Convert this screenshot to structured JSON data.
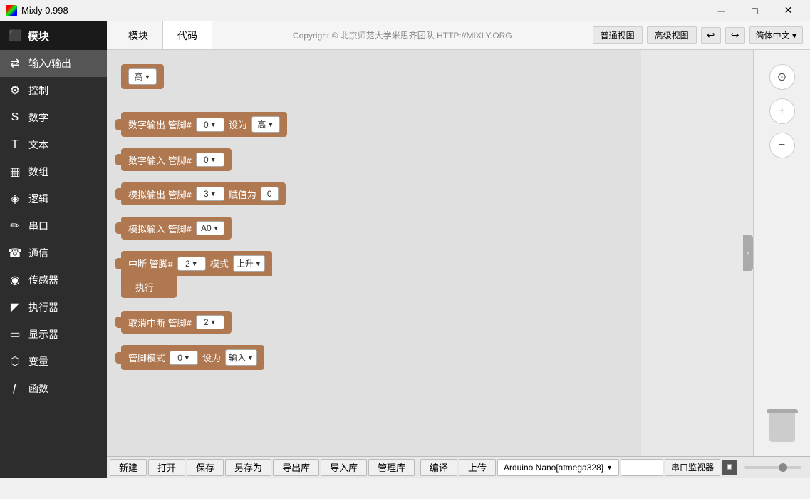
{
  "titlebar": {
    "icon_label": "M",
    "title": "Mixly 0.998",
    "minimize": "─",
    "maximize": "□",
    "close": "✕"
  },
  "tabs": {
    "blocks_label": "模块",
    "code_label": "代码"
  },
  "topbar": {
    "copyright": "Copyright © 北京师范大学米思齐团队 HTTP://MIXLY.ORG",
    "normal_view": "普通视图",
    "advanced_view": "高级视图",
    "undo": "↩",
    "redo": "↪",
    "lang": "简体中文 ▾"
  },
  "sidebar": {
    "header_label": "模块",
    "items": [
      {
        "id": "io",
        "label": "输入/输出",
        "icon": "⇄",
        "active": true
      },
      {
        "id": "control",
        "label": "控制",
        "icon": "⚙"
      },
      {
        "id": "math",
        "label": "数学",
        "icon": "S"
      },
      {
        "id": "text",
        "label": "文本",
        "icon": "T"
      },
      {
        "id": "array",
        "label": "数组",
        "icon": "▦"
      },
      {
        "id": "logic",
        "label": "逻辑",
        "icon": "◈"
      },
      {
        "id": "serial",
        "label": "串口",
        "icon": "✏"
      },
      {
        "id": "comms",
        "label": "通信",
        "icon": "☎"
      },
      {
        "id": "sensors",
        "label": "传感器",
        "icon": "◉"
      },
      {
        "id": "actuators",
        "label": "执行器",
        "icon": "◤"
      },
      {
        "id": "display",
        "label": "显示器",
        "icon": "▭"
      },
      {
        "id": "vars",
        "label": "变量",
        "icon": "⬡"
      },
      {
        "id": "funcs",
        "label": "函数",
        "icon": "ƒ"
      }
    ]
  },
  "blocks": [
    {
      "id": "digital-high",
      "type": "standalone",
      "text": "高",
      "has_dropdown": true
    },
    {
      "id": "digital-output",
      "type": "normal",
      "label": "数字输出 管脚#",
      "pin_value": "0",
      "pin_dropdown": true,
      "set_label": "设为",
      "set_value": "高",
      "set_dropdown": true
    },
    {
      "id": "digital-input",
      "type": "normal",
      "label": "数字输入 管脚#",
      "pin_value": "0",
      "pin_dropdown": true
    },
    {
      "id": "analog-output",
      "type": "normal",
      "label": "模拟输出 管脚#",
      "pin_value": "3",
      "pin_dropdown": true,
      "assign_label": "赋值为",
      "assign_value": "0"
    },
    {
      "id": "analog-input",
      "type": "normal",
      "label": "模拟输入 管脚#",
      "pin_value": "A0",
      "pin_dropdown": true
    },
    {
      "id": "interrupt",
      "type": "interrupt",
      "line1_label": "中断 管脚#",
      "pin_value": "2",
      "pin_dropdown": true,
      "mode_label": "模式",
      "mode_value": "上升",
      "mode_dropdown": true,
      "line2_label": "执行"
    },
    {
      "id": "cancel-interrupt",
      "type": "normal",
      "label": "取消中断 管脚#",
      "pin_value": "2",
      "pin_dropdown": true
    },
    {
      "id": "pin-mode",
      "type": "normal",
      "label": "管脚模式",
      "pin_value": "0",
      "pin_dropdown": true,
      "set_label": "设为",
      "set_value": "输入",
      "set_dropdown": true
    }
  ],
  "bottombar": {
    "new": "新建",
    "open": "打开",
    "save": "保存",
    "save_as": "另存为",
    "export_lib": "导出库",
    "import_lib": "导入库",
    "manage_lib": "管理库",
    "compile": "编译",
    "upload": "上传",
    "board": "Arduino Nano[atmega328]",
    "serial_monitor": "串口监视器",
    "chip_icon": "⬛"
  }
}
